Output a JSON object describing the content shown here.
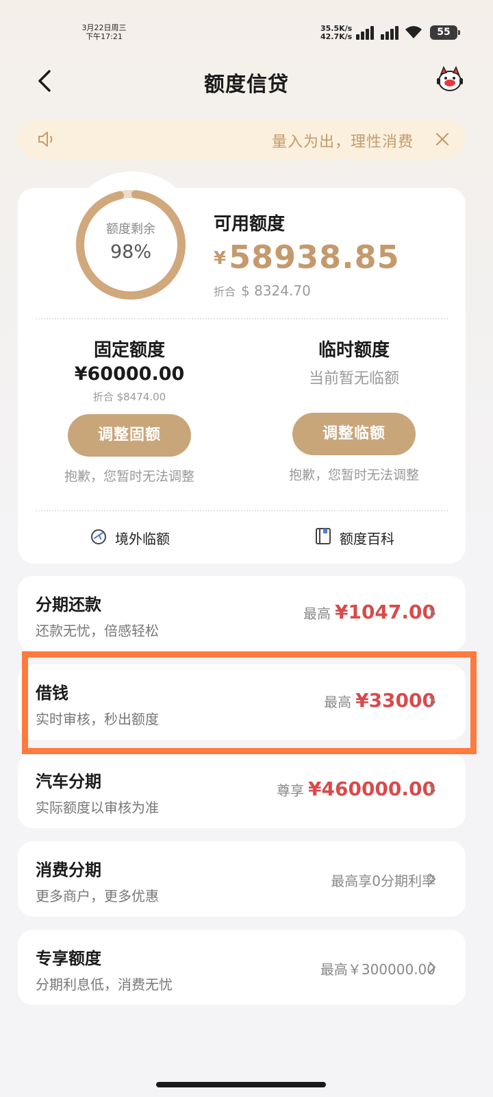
{
  "status_bar": {
    "date": "3月22日周三",
    "time": "下午17:21",
    "upload_speed": "35.5K/s",
    "download_speed": "42.7K/s",
    "battery": "55"
  },
  "header": {
    "title": "额度信贷"
  },
  "notice": {
    "text": "量入为出，理性消费"
  },
  "credit": {
    "remaining_label": "额度剩余",
    "remaining_percent": "98%",
    "remaining_fraction": 0.98,
    "available_label": "可用额度",
    "available_currency": "¥",
    "available_amount": "58938.85",
    "usd_prefix": "折合",
    "usd_amount": "$ 8324.70",
    "fixed": {
      "title": "固定额度",
      "amount": "¥60000.00",
      "usd": "折合 $8474.00",
      "button": "调整固额",
      "note": "抱歉，您暂时无法调整"
    },
    "temporary": {
      "title": "临时额度",
      "status": "当前暂无临额",
      "button": "调整临额",
      "note": "抱歉，您暂时无法调整"
    },
    "links": {
      "overseas": "境外临额",
      "wiki": "额度百科"
    }
  },
  "rows": [
    {
      "title": "分期还款",
      "subtitle": "还款无忧，倍感轻松",
      "prefix": "最高",
      "value": "¥1047.00"
    },
    {
      "title": "借钱",
      "subtitle": "实时审核，秒出额度",
      "prefix": "最高",
      "value": "¥33000"
    },
    {
      "title": "汽车分期",
      "subtitle": "实际额度以审核为准",
      "prefix": "尊享",
      "value": "¥460000.00"
    },
    {
      "title": "消费分期",
      "subtitle": "更多商户，更多优惠",
      "plain": "最高享0分期利率"
    },
    {
      "title": "专享额度",
      "subtitle": "分期利息低，消费无忧",
      "plain": "最高￥300000.00"
    }
  ],
  "colors": {
    "accent_gold": "#c9a57a",
    "amount_gold": "#c49a6c",
    "value_red": "#d94a4a",
    "highlight_orange": "#ff7a3d"
  }
}
